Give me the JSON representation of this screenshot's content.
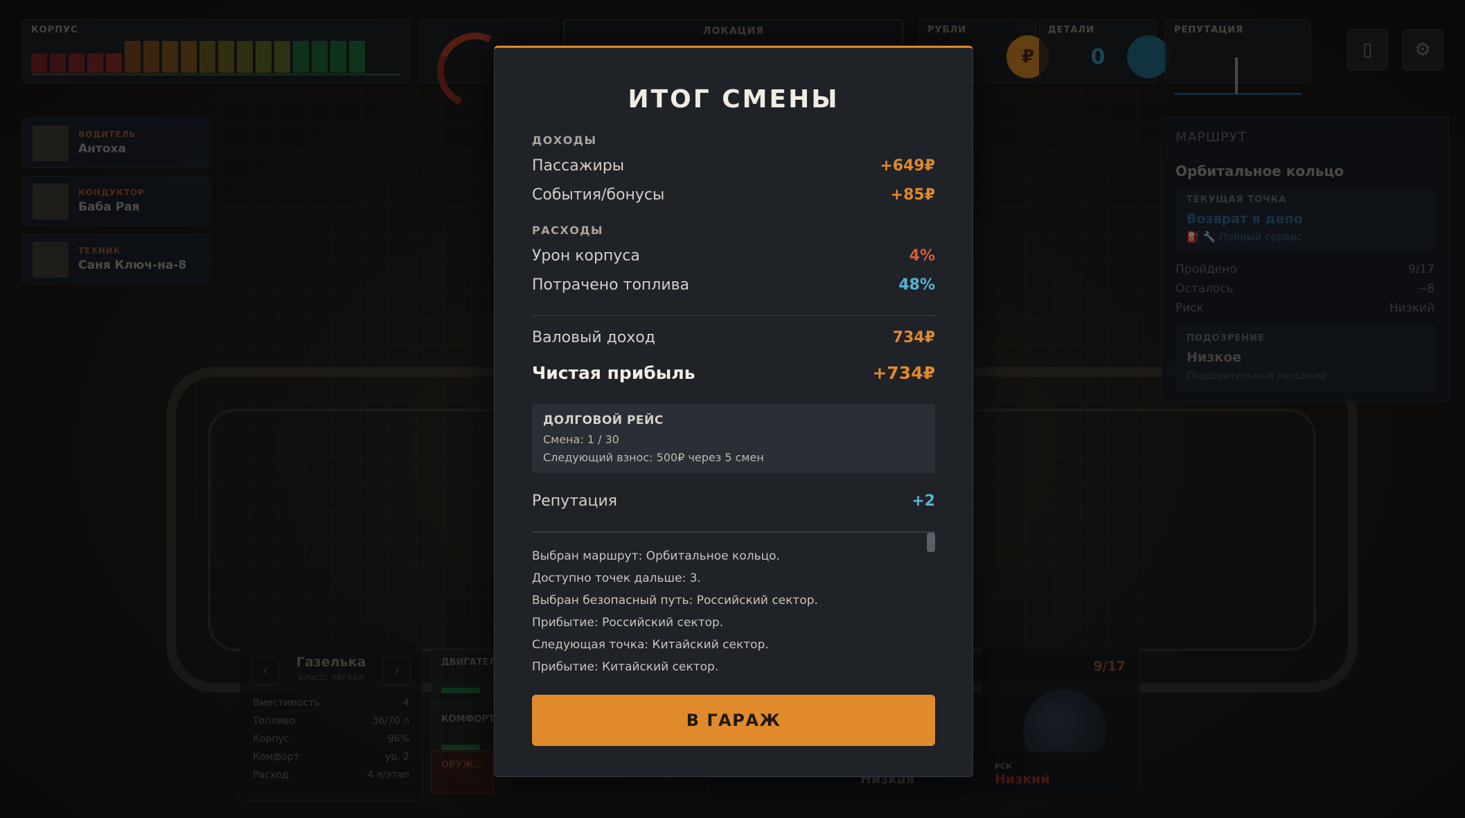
{
  "hud": {
    "hull_label": "КОРПУС",
    "location_label": "ЛОКАЦИЯ",
    "money_label": "РУБЛИ",
    "money_icon": "₽",
    "parts_label": "ДЕТАЛИ",
    "parts_value": "0",
    "reputation_label": "РЕПУТАЦИЯ",
    "book_icon": "book-icon",
    "settings_icon": "gear-icon"
  },
  "crew": [
    {
      "role": "ВОДИТЕЛЬ",
      "name": "Антоха"
    },
    {
      "role": "КОНДУКТОР",
      "name": "Баба Рая"
    },
    {
      "role": "ТЕХНИК",
      "name": "Саня Ключ-на-8"
    }
  ],
  "route": {
    "title": "МАРШРУТ",
    "name": "Орбитальное кольцо",
    "current_label": "ТЕКУЩАЯ ТОЧКА",
    "current_point": "Возврат в депо",
    "service": "Полный сервис",
    "passed_label": "Пройдено",
    "passed_value": "9/17",
    "left_label": "Осталось",
    "left_value": "~8",
    "risk_label": "Риск",
    "risk_value": "Низкий",
    "suspicion_label": "ПОДОЗРЕНИЕ",
    "suspicion_value": "Низкое",
    "suspicion_note": "Подозрительный пассажир"
  },
  "vehicle": {
    "name": "Газелька",
    "class": "класс: лёгкая",
    "stats": [
      {
        "label": "Вместимость",
        "value": "4"
      },
      {
        "label": "Топливо",
        "value": "36/70 л"
      },
      {
        "label": "Корпус",
        "value": "96%"
      },
      {
        "label": "Комфорт",
        "value": "ур. 2"
      },
      {
        "label": "Расход",
        "value": "4 л/этап"
      }
    ],
    "modules": [
      "ДВИГАТЕЛЬ",
      "КОМФОРТ",
      "ОРУЖ..."
    ]
  },
  "map": {
    "progress": "9/17",
    "risk_short_label": "РСК",
    "risk_value": "Низкий",
    "level_value": "Низкая"
  },
  "modal": {
    "title": "ИТОГ СМЕНЫ",
    "income_label": "ДОХОДЫ",
    "passengers_label": "Пассажиры",
    "passengers_value": "+649₽",
    "events_label": "События/бонусы",
    "events_value": "+85₽",
    "expenses_label": "РАСХОДЫ",
    "hull_damage_label": "Урон корпуса",
    "hull_damage_value": "4%",
    "fuel_label": "Потрачено топлива",
    "fuel_value": "48%",
    "gross_label": "Валовый доход",
    "gross_value": "734₽",
    "net_label": "Чистая прибыль",
    "net_value": "+734₽",
    "debt_title": "ДОЛГОВОЙ РЕЙС",
    "debt_shift": "Смена: 1 / 30",
    "debt_next": "Следующий взнос: 500₽ через 5 смен",
    "reputation_label": "Репутация",
    "reputation_value": "+2",
    "log": [
      "Выбран маршрут: Орбитальное кольцо.",
      "Доступно точек дальше: 3.",
      "Выбран безопасный путь: Российский сектор.",
      "Прибытие: Российский сектор.",
      "Следующая точка: Китайский сектор.",
      "Прибытие: Китайский сектор."
    ],
    "button_label": "В ГАРАЖ"
  },
  "colors": {
    "accent": "#e08a2c",
    "negative": "#d65a3c",
    "info": "#58b3d0",
    "panel": "#1f2227"
  }
}
